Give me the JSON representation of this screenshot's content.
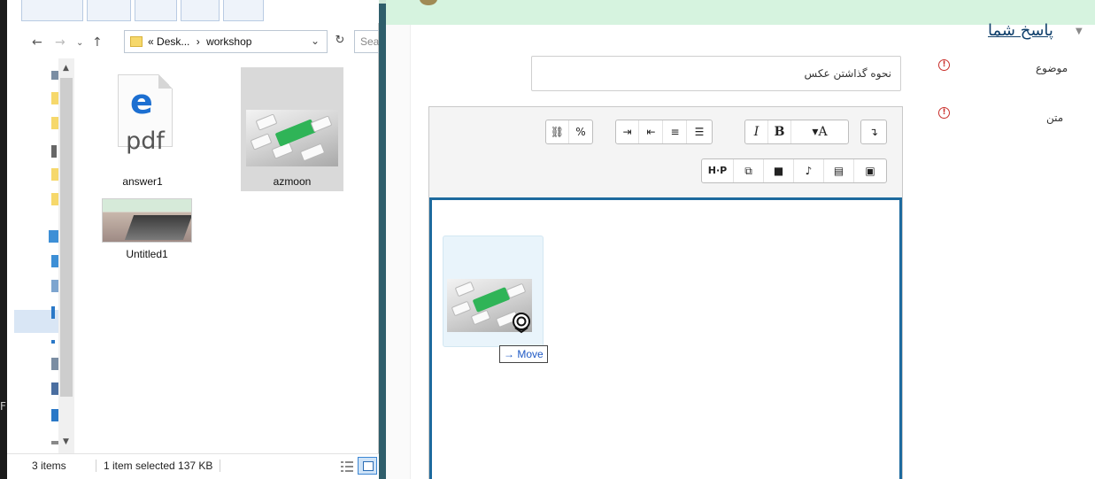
{
  "explorer": {
    "address": {
      "prefix": "«",
      "path_1": "Desk...",
      "separator": "›",
      "path_2": "workshop"
    },
    "search_placeholder": "Sea",
    "files": [
      {
        "name": "answer1",
        "icon": "edge-pdf-icon",
        "badge": "pdf"
      },
      {
        "name": "azmoon",
        "icon": "image-thumbnail"
      },
      {
        "name": "Untitled1",
        "icon": "image-thumbnail"
      }
    ],
    "status": {
      "count": "3 items",
      "selected": "1 item selected  137 KB"
    }
  },
  "left_edge_letter": "F",
  "form": {
    "section_title": "پاسخ شما",
    "subject_label": "موضوع",
    "text_label": "متن",
    "required_symbol": "!",
    "subject_value": "نحوه گذاشتن عکس"
  },
  "editor": {
    "toolbar_row1": [
      {
        "name": "unlink-icon",
        "glyph": "⛓"
      },
      {
        "name": "link-icon",
        "glyph": "%"
      },
      {
        "name": "indent-icon",
        "glyph": "⇥"
      },
      {
        "name": "outdent-icon",
        "glyph": "⇤"
      },
      {
        "name": "ordered-list-icon",
        "glyph": "≡"
      },
      {
        "name": "unordered-list-icon",
        "glyph": "☰"
      },
      {
        "name": "italic-button",
        "glyph": "I"
      },
      {
        "name": "bold-button",
        "glyph": "B"
      },
      {
        "name": "paragraph-styles-button",
        "glyph": "▾A"
      },
      {
        "name": "toolbar-toggle-button",
        "glyph": "↴"
      }
    ],
    "toolbar_row2": [
      {
        "name": "h5p-button",
        "glyph": "H·P"
      },
      {
        "name": "manage-files-icon",
        "glyph": "⧉"
      },
      {
        "name": "video-icon",
        "glyph": "■"
      },
      {
        "name": "microphone-icon",
        "glyph": "♪"
      },
      {
        "name": "media-icon",
        "glyph": "▤"
      },
      {
        "name": "image-icon",
        "glyph": "▣"
      }
    ],
    "drag_label": "→ Move"
  },
  "colors": {
    "editor_focus_border": "#1d6a9e",
    "required": "#c9302c",
    "link": "#0f3f6b",
    "topstrip": "#d6f3df"
  }
}
